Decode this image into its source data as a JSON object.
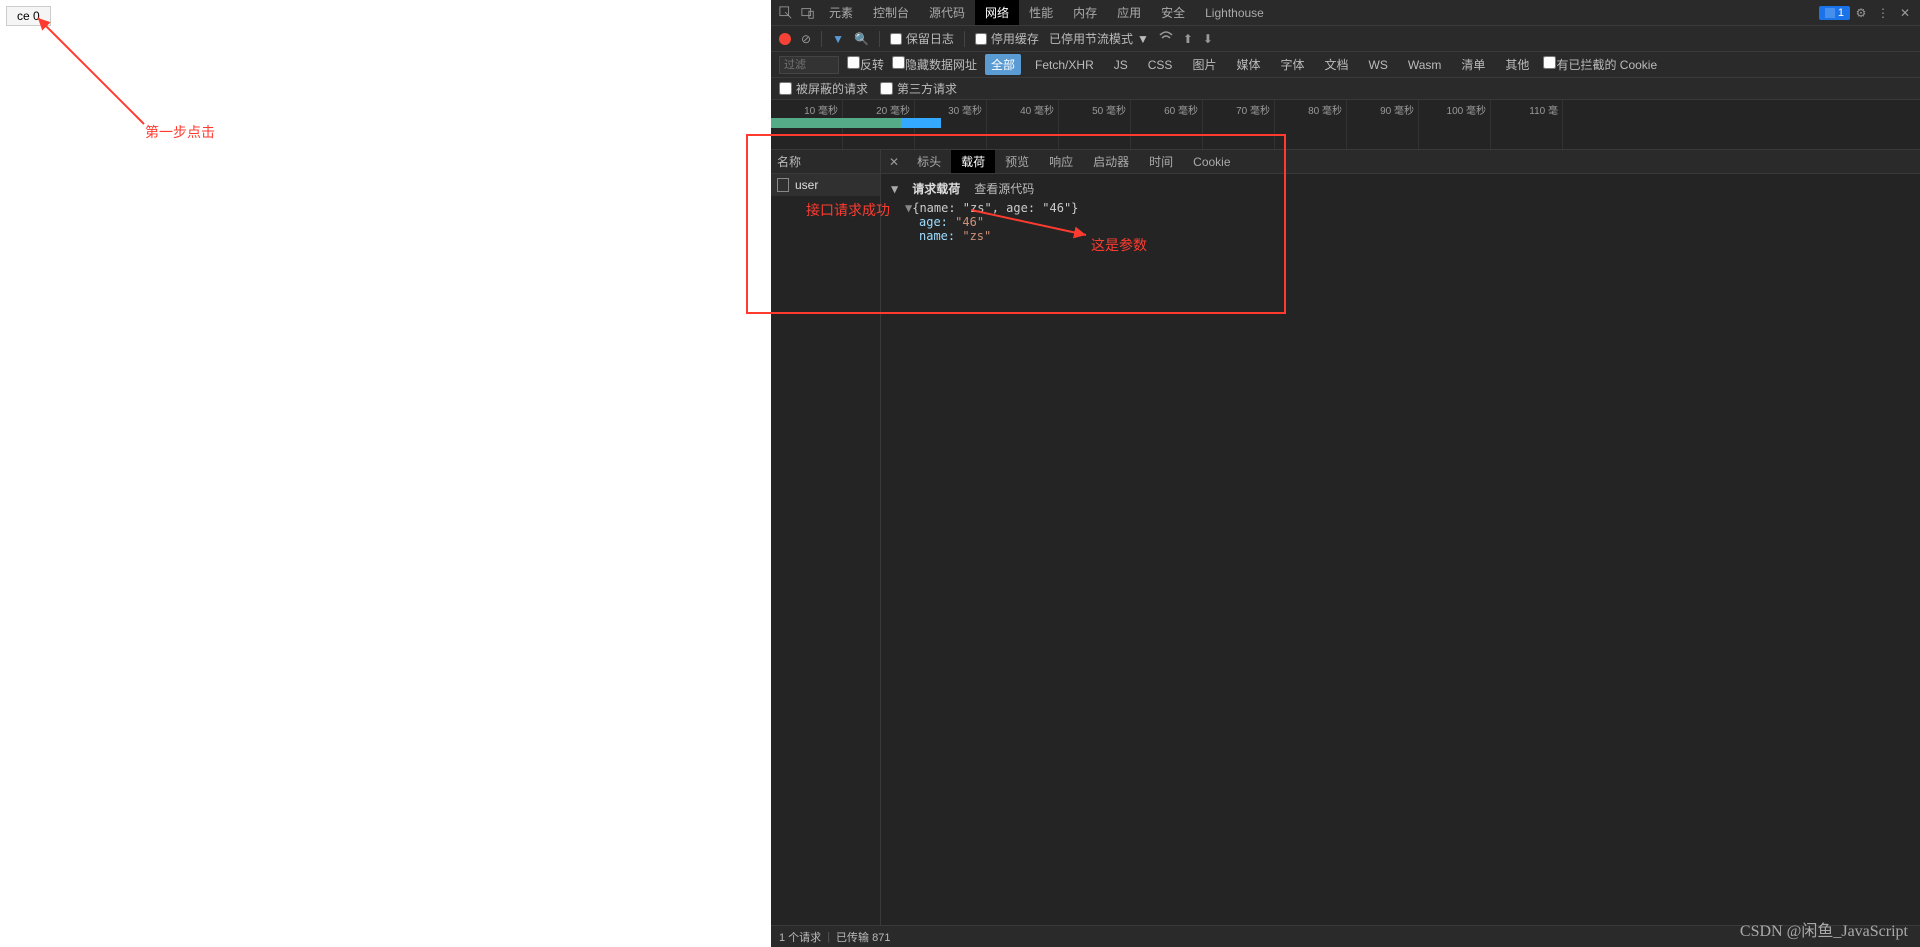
{
  "page": {
    "button_label": "ce 0"
  },
  "devtools": {
    "tabs": [
      "元素",
      "控制台",
      "源代码",
      "网络",
      "性能",
      "内存",
      "应用",
      "安全",
      "Lighthouse"
    ],
    "active_tab_index": 3,
    "issue_badge": "1"
  },
  "toolbar": {
    "preserve_log": "保留日志",
    "disable_cache": "停用缓存",
    "throttling": "已停用节流模式"
  },
  "filterbar": {
    "label": "过滤",
    "invert": "反转",
    "hide_data_urls": "隐藏数据网址",
    "chips": [
      "全部",
      "Fetch/XHR",
      "JS",
      "CSS",
      "图片",
      "媒体",
      "字体",
      "文档",
      "WS",
      "Wasm",
      "清单",
      "其他"
    ],
    "active_chip_index": 0,
    "blocked_cookies": "有已拦截的 Cookie"
  },
  "hidebar": {
    "hidden_requests": "被屏蔽的请求",
    "third_party": "第三方请求"
  },
  "timeline": {
    "ticks": [
      "10 毫秒",
      "20 毫秒",
      "30 毫秒",
      "40 毫秒",
      "50 毫秒",
      "60 毫秒",
      "70 毫秒",
      "80 毫秒",
      "90 毫秒",
      "100 毫秒",
      "110 毫"
    ]
  },
  "request_list": {
    "header": "名称",
    "items": [
      "user"
    ]
  },
  "detail": {
    "tabs": [
      "标头",
      "载荷",
      "预览",
      "响应",
      "启动器",
      "时间",
      "Cookie"
    ],
    "active_index": 1,
    "payload_title": "请求载荷",
    "view_source": "查看源代码",
    "object_summary": "{name: \"zs\", age: \"46\"}",
    "props": [
      {
        "key": "age:",
        "val": "\"46\""
      },
      {
        "key": "name:",
        "val": "\"zs\""
      }
    ]
  },
  "status_bar": {
    "requests": "1 个请求",
    "transferred": "已传输 871"
  },
  "annotations": {
    "step1": "第一步点击",
    "api_success": "接口请求成功",
    "params": "这是参数"
  },
  "watermark": "CSDN @闲鱼_JavaScript"
}
